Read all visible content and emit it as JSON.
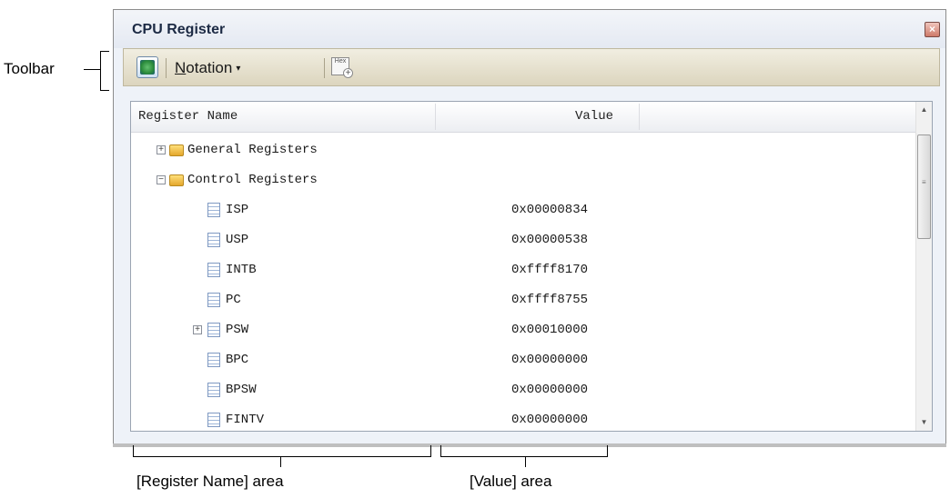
{
  "annotations": {
    "toolbar": "Toolbar",
    "register_name_area": "[Register Name] area",
    "value_area": "[Value] area"
  },
  "window": {
    "title": "CPU Register",
    "close_icon": "close-icon"
  },
  "toolbar": {
    "refresh_icon": "refresh-icon",
    "notation_first": "N",
    "notation_rest": "otation",
    "notation_caret": "▾",
    "hex_label": "Hex",
    "hex_plus": "+"
  },
  "table": {
    "headers": {
      "name": "Register Name",
      "value": "Value"
    },
    "rows": [
      {
        "name": "General Registers",
        "value": "",
        "kind": "folder",
        "expander": "+"
      },
      {
        "name": "Control Registers",
        "value": "",
        "kind": "folder-open",
        "expander": "−"
      },
      {
        "name": "ISP",
        "value": "0x00000834",
        "kind": "register",
        "expander": ""
      },
      {
        "name": "USP",
        "value": "0x00000538",
        "kind": "register",
        "expander": ""
      },
      {
        "name": "INTB",
        "value": "0xffff8170",
        "kind": "register",
        "expander": ""
      },
      {
        "name": "PC",
        "value": "0xffff8755",
        "kind": "register",
        "expander": ""
      },
      {
        "name": "PSW",
        "value": "0x00010000",
        "kind": "register",
        "expander": "+"
      },
      {
        "name": "BPC",
        "value": "0x00000000",
        "kind": "register",
        "expander": ""
      },
      {
        "name": "BPSW",
        "value": "0x00000000",
        "kind": "register",
        "expander": ""
      },
      {
        "name": "FINTV",
        "value": "0x00000000",
        "kind": "register",
        "expander": ""
      }
    ]
  },
  "scrollbar": {
    "up": "▲",
    "down": "▼",
    "grip": "≡"
  }
}
